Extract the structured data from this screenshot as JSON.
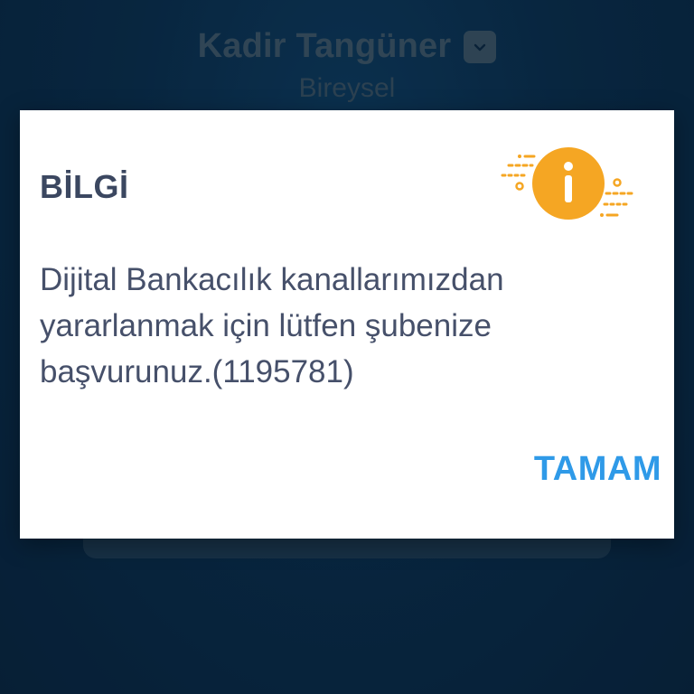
{
  "background": {
    "user_name": "Kadir Tangüner",
    "account_type": "Bireysel",
    "chevron_icon": "chevron-down-icon"
  },
  "dialog": {
    "title": "BİLGİ",
    "icon": "info-icon",
    "message": "Dijital Bankacılık kanallarımızdan yararlanmak için lütfen şubenize başvurunuz.(1195781)",
    "button_label": "TAMAM"
  },
  "colors": {
    "background": "#0a2c4a",
    "accent_orange": "#f5a623",
    "button_blue": "#2f9ae8",
    "title_text": "#3b4760",
    "body_text": "#46506a"
  }
}
